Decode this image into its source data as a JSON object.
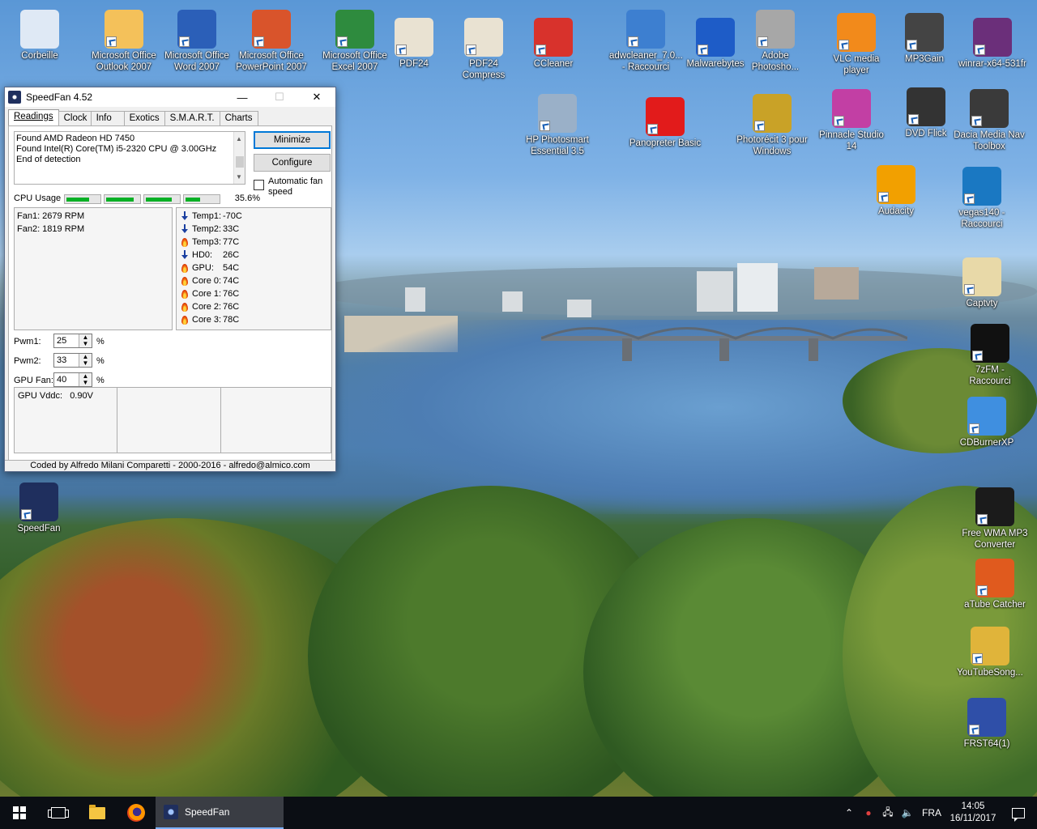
{
  "desktop": {
    "icons": [
      {
        "id": "recycle",
        "label": "Corbeille",
        "color": "#dfe9f5"
      },
      {
        "id": "outlook",
        "label": "Microsoft Office Outlook 2007",
        "color": "#f4c15a"
      },
      {
        "id": "word",
        "label": "Microsoft Office Word 2007",
        "color": "#2b5fb8"
      },
      {
        "id": "powerpoint",
        "label": "Microsoft Office PowerPoint 2007",
        "color": "#d9542b"
      },
      {
        "id": "excel",
        "label": "Microsoft Office Excel 2007",
        "color": "#2e8b3e"
      },
      {
        "id": "pdf24",
        "label": "PDF24",
        "color": "#e9e2d2"
      },
      {
        "id": "pdf24compress",
        "label": "PDF24 Compress",
        "color": "#e9e2d2"
      },
      {
        "id": "ccleaner",
        "label": "CCleaner",
        "color": "#d8322c"
      },
      {
        "id": "adwcleaner",
        "label": "adwcleaner_7.0... - Raccourci",
        "color": "#3d7fd0"
      },
      {
        "id": "malwarebytes",
        "label": "Malwarebytes",
        "color": "#1e5cc7"
      },
      {
        "id": "photoshop",
        "label": "Adobe Photosho...",
        "color": "#a7a7a7"
      },
      {
        "id": "vlc",
        "label": "VLC media player",
        "color": "#f28a1b"
      },
      {
        "id": "mp3gain",
        "label": "MP3Gain",
        "color": "#444444"
      },
      {
        "id": "winrar",
        "label": "winrar-x64-531fr",
        "color": "#6b2f7a"
      },
      {
        "id": "hpphotosmart",
        "label": "HP Photosmart Essential 3.5",
        "color": "#9ab0c8"
      },
      {
        "id": "panopreter",
        "label": "Panopreter Basic",
        "color": "#e21b1b"
      },
      {
        "id": "photorecit",
        "label": "Photorécit 3 pour Windows",
        "color": "#c9a227"
      },
      {
        "id": "pinnacle",
        "label": "Pinnacle Studio 14",
        "color": "#c23fa4"
      },
      {
        "id": "dvdflick",
        "label": "DVD Flick",
        "color": "#333333"
      },
      {
        "id": "dacia",
        "label": "Dacia Media Nav Toolbox",
        "color": "#3a3a3a"
      },
      {
        "id": "audacity",
        "label": "Audacity",
        "color": "#f2a000"
      },
      {
        "id": "vegas",
        "label": "vegas140 - Raccourci",
        "color": "#1a78c2"
      },
      {
        "id": "captvty",
        "label": "Captvty",
        "color": "#e8d9a8"
      },
      {
        "id": "7zfm",
        "label": "7zFM - Raccourci",
        "color": "#111111"
      },
      {
        "id": "cdburnerxp",
        "label": "CDBurnerXP",
        "color": "#3f8fe0"
      },
      {
        "id": "speedfan",
        "label": "SpeedFan",
        "color": "#1f2f5e"
      },
      {
        "id": "freewma",
        "label": "Free WMA MP3 Converter",
        "color": "#1b1b1b"
      },
      {
        "id": "atube",
        "label": "aTube Catcher",
        "color": "#e05a1e"
      },
      {
        "id": "youtubesong",
        "label": "YouTubeSong...",
        "color": "#e0b43a"
      },
      {
        "id": "frst",
        "label": "FRST64(1)",
        "color": "#2f4fa8"
      }
    ]
  },
  "window": {
    "title": "SpeedFan 4.52",
    "minimize_glyph": "—",
    "maximize_glyph": "☐",
    "close_glyph": "✕",
    "tabs": [
      "Readings",
      "Clock",
      "Info",
      "Exotics",
      "S.M.A.R.T.",
      "Charts"
    ],
    "log": [
      "Found AMD Radeon HD 7450",
      "Found Intel(R) Core(TM) i5-2320 CPU @ 3.00GHz",
      "End of detection"
    ],
    "minimize_label": "Minimize",
    "configure_label": "Configure",
    "autofan_label": "Automatic fan speed",
    "cpu_usage_label": "CPU Usage",
    "cpu_usage_value": "35.6%",
    "cpu_meters": [
      0.7,
      0.85,
      0.8,
      0.45
    ],
    "fans": [
      "Fan1: 2679 RPM",
      "Fan2: 1819 RPM"
    ],
    "temps": [
      {
        "name": "Temp1:",
        "value": "-70C",
        "trend": "down"
      },
      {
        "name": "Temp2:",
        "value": "33C",
        "trend": "down"
      },
      {
        "name": "Temp3:",
        "value": "77C",
        "trend": "hot"
      },
      {
        "name": "HD0:",
        "value": "26C",
        "trend": "down"
      },
      {
        "name": "GPU:",
        "value": "54C",
        "trend": "hot"
      },
      {
        "name": "Core 0:",
        "value": "74C",
        "trend": "hot"
      },
      {
        "name": "Core 1:",
        "value": "76C",
        "trend": "hot"
      },
      {
        "name": "Core 2:",
        "value": "76C",
        "trend": "hot"
      },
      {
        "name": "Core 3:",
        "value": "78C",
        "trend": "hot"
      }
    ],
    "pwm": [
      {
        "label": "Pwm1:",
        "value": "25",
        "unit": "%"
      },
      {
        "label": "Pwm2:",
        "value": "33",
        "unit": "%"
      },
      {
        "label": "GPU Fan:",
        "value": "40",
        "unit": "%"
      }
    ],
    "vddc": "GPU Vddc:   0.90V",
    "status": "Coded by Alfredo Milani Comparetti - 2000-2016 - alfredo@almico.com"
  },
  "taskbar": {
    "app_label": "SpeedFan",
    "language": "FRA",
    "time": "14:05",
    "date": "16/11/2017"
  }
}
